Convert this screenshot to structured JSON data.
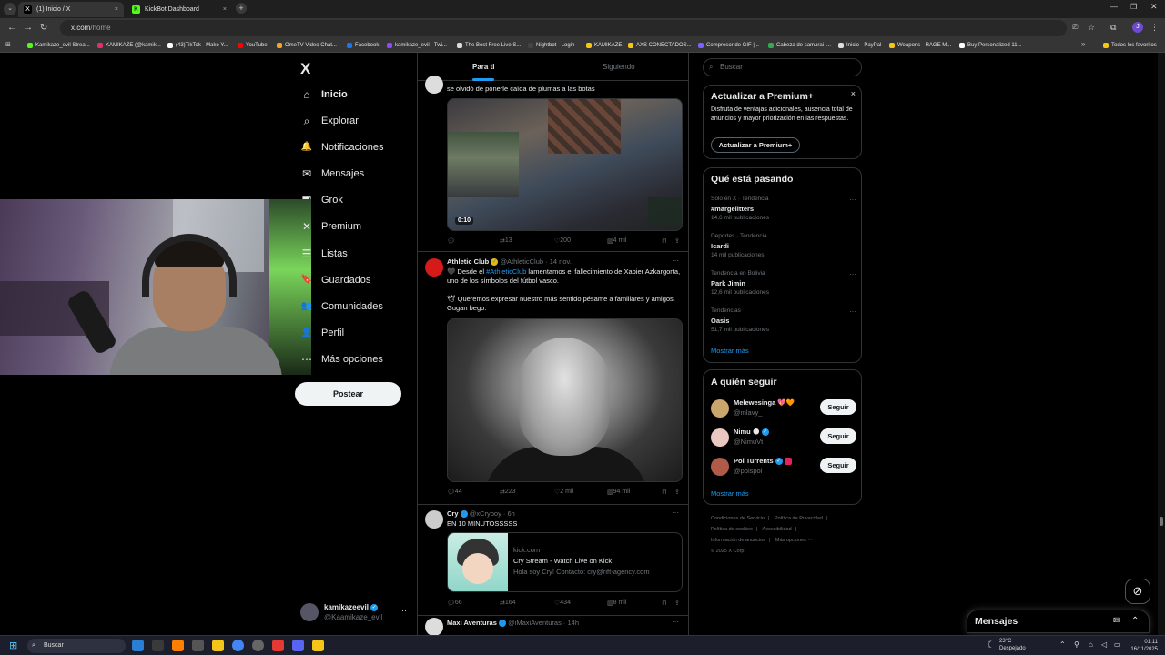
{
  "browser": {
    "tabs": [
      {
        "label": "(1) Inicio / X",
        "close": "×"
      },
      {
        "label": "KickBot Dashboard",
        "close": "×"
      }
    ],
    "new_tab": "+",
    "url_host": "x.com",
    "url_path": "/home",
    "bookmarks": [
      "Kamikaze_evil Strea...",
      "KAMIKAZE (@kamik...",
      "(43)TikTok - Make Y...",
      "YouTube",
      "OmeTV Video Chat...",
      "Facebook",
      "kamikaze_evil - Twi...",
      "The Best Free Live S...",
      "Nightbot - Login",
      "KAMIKAZE",
      "AXS CONECTADOS...",
      "Compresor de GIF |...",
      "Cabeza de samurai l...",
      "Inicio - PayPal",
      "Weapons - RAGE M...",
      "Buy Personalized 11..."
    ],
    "bookmarks_more": "»",
    "all_bookmarks": "Todos los favoritos",
    "profile_initial": "J"
  },
  "sidebar": {
    "logo": "X",
    "items": [
      {
        "label": "Inicio",
        "icon": "⌂"
      },
      {
        "label": "Explorar",
        "icon": "⌕"
      },
      {
        "label": "Notificaciones",
        "icon": "🔔"
      },
      {
        "label": "Mensajes",
        "icon": "✉"
      },
      {
        "label": "Grok",
        "icon": "◩"
      },
      {
        "label": "Premium",
        "icon": "✕"
      },
      {
        "label": "Listas",
        "icon": "☰"
      },
      {
        "label": "Guardados",
        "icon": "🔖"
      },
      {
        "label": "Comunidades",
        "icon": "👥"
      },
      {
        "label": "Perfil",
        "icon": "👤"
      },
      {
        "label": "Más opciones",
        "icon": "⋯"
      }
    ],
    "post_button": "Postear",
    "account_name": "kamikazeevil",
    "account_handle": "@Kaamikaze_evil",
    "account_more": "···"
  },
  "feed": {
    "tabs": [
      "Para ti",
      "Siguiendo"
    ],
    "tweets": [
      {
        "text": "se olvidó de ponerle caída de plumas a las botas",
        "duration": "0:10",
        "replies": "",
        "retweets": "13",
        "likes": "200",
        "views": "4 mil"
      },
      {
        "name": "Athletic Club",
        "handle": "@AthleticClub",
        "date": "· 14 nov.",
        "text_pre": "🖤 Desde el ",
        "text_link": "#AthleticClub",
        "text_post": " lamentamos el fallecimiento de Xabier Azkargorta, uno de los símbolos del fútbol vasco.",
        "text2": "🕊 Queremos expresar nuestro más sentido pésame a familiares y amigos. Gugan bego.",
        "replies": "44",
        "retweets": "223",
        "likes": "2 mil",
        "views": "94 mil"
      },
      {
        "name": "Cry",
        "handle": "@xCryboy",
        "date": "· 6h",
        "text": "EN 10 MINUTOSSSSS",
        "card_domain": "kick.com",
        "card_title": "Cry Stream - Watch Live on Kick",
        "card_desc": "Hola soy Cry! Contacto: cry@rift-agency.com",
        "replies": "66",
        "retweets": "164",
        "likes": "434",
        "views": "8 mil"
      },
      {
        "name": "Maxi Aventuras",
        "handle": "@iMaxiAventuras",
        "date": "· 14h"
      }
    ]
  },
  "right": {
    "search_placeholder": "Buscar",
    "premium": {
      "title": "Actualizar a Premium+",
      "body": "Disfruta de ventajas adicionales, ausencia total de anuncios y mayor priorización en las respuestas.",
      "button": "Actualizar a Premium+",
      "close": "×"
    },
    "trends": {
      "title": "Qué está pasando",
      "items": [
        {
          "context": "Solo en X · Tendencia",
          "name": "#margelitters",
          "count": "14,6 mil publicaciones"
        },
        {
          "context": "Deportes · Tendencia",
          "name": "Icardi",
          "count": "14 mil publicaciones"
        },
        {
          "context": "Tendencia en Bolivia",
          "name": "Park Jimin",
          "count": "12,6 mil publicaciones"
        },
        {
          "context": "Tendencias",
          "name": "Oasis",
          "count": "51,7 mil publicaciones"
        }
      ],
      "show_more": "Mostrar más"
    },
    "follow": {
      "title": "A quién seguir",
      "items": [
        {
          "name": "Melewesinga 💖🧡",
          "handle": "@mlavy_",
          "button": "Seguir"
        },
        {
          "name": "Nimu 🌑",
          "handle": "@NimuVt",
          "button": "Seguir"
        },
        {
          "name": "Pol Turrents",
          "handle": "@polspol",
          "button": "Seguir"
        }
      ],
      "show_more": "Mostrar más"
    },
    "footer": [
      "Condiciones de Servicio",
      "Política de Privacidad",
      "Política de cookies",
      "Accesibilidad",
      "Información de anuncios",
      "Más opciones ···",
      "© 2025 X Corp."
    ],
    "messages": "Mensajes"
  },
  "taskbar": {
    "search": "Buscar",
    "temp": "23°C",
    "condition": "Despejado",
    "time": "01:11",
    "date": "16/11/2025"
  }
}
